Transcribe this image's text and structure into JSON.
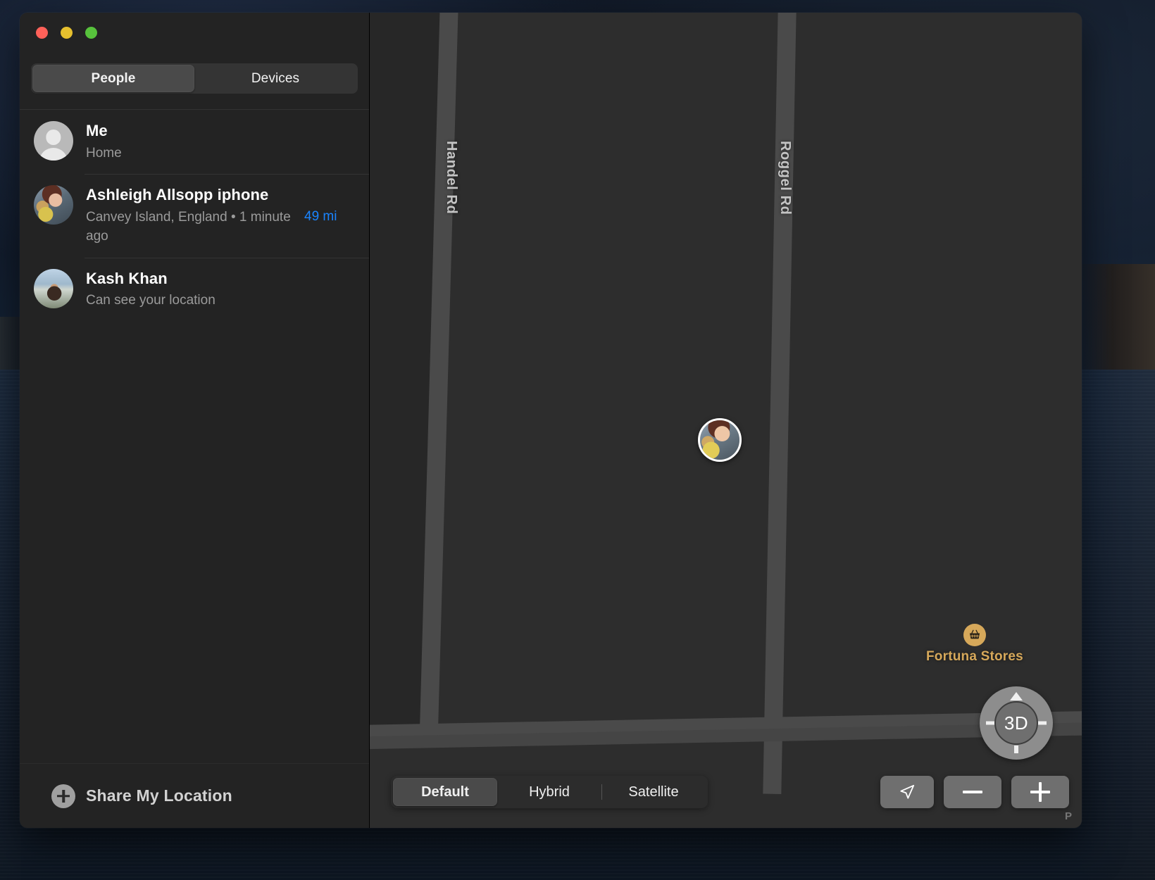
{
  "window": {
    "traffic_lights": [
      {
        "name": "close",
        "color": "#ff6159"
      },
      {
        "name": "minimize",
        "color": "#e6c02e"
      },
      {
        "name": "zoom",
        "color": "#57c23c"
      }
    ]
  },
  "sidebar": {
    "tabs": [
      {
        "label": "People",
        "selected": true
      },
      {
        "label": "Devices",
        "selected": false
      }
    ],
    "people": [
      {
        "name": "Me",
        "subtitle": "Home",
        "distance": "",
        "avatar": "silhouette-avatar"
      },
      {
        "name": "Ashleigh Allsopp iphone",
        "subtitle": "Canvey Island, England • 1 minute ago",
        "distance": "49 mi",
        "avatar": "photo-avatar-ashleigh"
      },
      {
        "name": "Kash Khan",
        "subtitle": "Can see your location",
        "distance": "",
        "avatar": "photo-avatar-kash"
      }
    ],
    "share": {
      "label": "Share My Location",
      "icon": "plus-circle-icon"
    }
  },
  "map": {
    "road_labels": [
      "Handel Rd",
      "Roggel Rd"
    ],
    "poi": {
      "label": "Fortuna Stores",
      "icon": "shopping-basket-icon",
      "color": "#d6a85a"
    },
    "pin": {
      "name": "ashleigh-location-pin"
    },
    "dial": {
      "center_label": "3D",
      "up": "tilt-up",
      "down": "tilt-down",
      "left": "rotate-left",
      "right": "rotate-right"
    },
    "map_types": [
      {
        "label": "Default",
        "selected": true
      },
      {
        "label": "Hybrid",
        "selected": false
      },
      {
        "label": "Satellite",
        "selected": false
      }
    ],
    "buttons": [
      {
        "name": "locate-button",
        "icon": "navigation-arrow-icon"
      },
      {
        "name": "zoom-out-button",
        "icon": "minus-icon"
      },
      {
        "name": "zoom-in-button",
        "icon": "plus-icon"
      }
    ],
    "watermark": "P"
  },
  "colors": {
    "accent_blue": "#1a84ff",
    "poi_gold": "#d6a85a",
    "sidebar_bg": "#232323",
    "map_bg": "#2d2d2d"
  }
}
